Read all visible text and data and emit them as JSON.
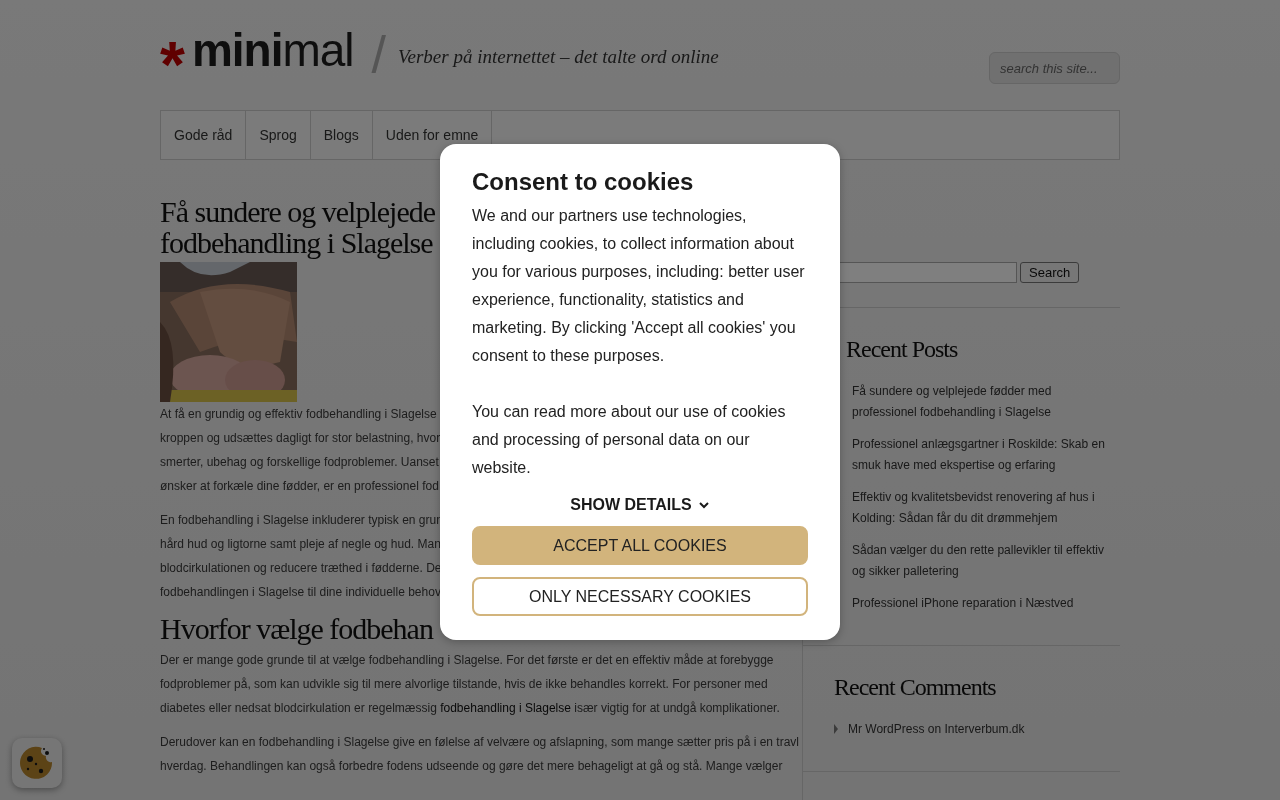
{
  "header": {
    "logo_mark": "*",
    "logo_bold": "mini",
    "logo_rest": "mal",
    "separator": "/",
    "tagline": "Verber på internettet – det talte ord online",
    "search": {
      "placeholder": "search this site..."
    }
  },
  "nav": [
    {
      "label": "Gode råd"
    },
    {
      "label": "Sprog"
    },
    {
      "label": "Blogs"
    },
    {
      "label": "Uden for emne"
    }
  ],
  "article": {
    "title_lines": [
      "Få sundere og velplejede",
      "fodbehandling i Slagelse"
    ],
    "image": {
      "kind": "picture"
    },
    "paragraphs": [
      {
        "lines": [
          "At få en grundig og effektiv fodbehandling i Slagelse",
          "kroppen og udsættes dagligt for stor belastning, hvor",
          "smerter, ubehag og forskellige fodproblemer. Uanset",
          "ønsker at forkæle dine fødder, er en professionel fod"
        ]
      },
      {
        "lines": [
          "En fodbehandling i Slagelse inkluderer typisk en grun",
          "hård hud og ligtorne samt pleje af negle og hud. Man",
          "blodcirkulationen og reducere træthed i fødderne. De",
          "fodbehandlingen i Slagelse til dine individuelle behov"
        ]
      }
    ],
    "subheading": "Hvorfor vælge fodbehan",
    "paragraphs_2": [
      {
        "lines": [
          "Der er mange gode grunde til at vælge fodbehandling i Slagelse. For det første er det en effektiv måde at forebygge",
          "fodproblemer på, som kan udvikle sig til mere alvorlige tilstande, hvis de ikke behandles korrekt. For personer med",
          "diabetes eller nedsat blodcirkulation er regelmæssig"
        ],
        "link": "fodbehandling i Slagelse",
        "after": "især vigtig for at undgå komplikationer."
      },
      {
        "lines": [
          "Derudover kan en fodbehandling i Slagelse give en følelse af velvære og afslapning, som mange sætter pris på i en travl",
          "hverdag. Behandlingen kan også forbedre fodens udseende og gøre det mere behageligt at gå og stå. Mange vælger"
        ]
      }
    ]
  },
  "sidebar": {
    "search_button": "Search",
    "widgets": [
      {
        "kind": "posts",
        "title": "Recent Posts",
        "items": [
          "Få sundere og velplejede fødder med professionel fodbehandling i Slagelse",
          "Professionel anlægsgartner i Roskilde: Skab en smuk have med ekspertise og erfaring",
          "Effektiv og kvalitetsbevidst renovering af hus i Kolding: Sådan får du dit drømmehjem",
          "Sådan vælger du den rette pallevikler til effektiv og sikker palletering",
          "Professionel iPhone reparation i Næstved"
        ]
      },
      {
        "kind": "comments",
        "title": "Recent Comments",
        "items": [
          "Mr WordPress on Interverbum.dk"
        ]
      }
    ]
  },
  "consent": {
    "title": "Consent to cookies",
    "body": [
      "We and our partners use technologies, including cookies, to collect information about you for various purposes, including: better user experience, functionality, statistics and marketing. By clicking 'Accept all cookies' you consent to these purposes.",
      "You can read more about our use of cookies and processing of personal data on our website."
    ],
    "details": "SHOW DETAILS",
    "accept": "ACCEPT ALL COOKIES",
    "necessary": "ONLY NECESSARY COOKIES"
  }
}
